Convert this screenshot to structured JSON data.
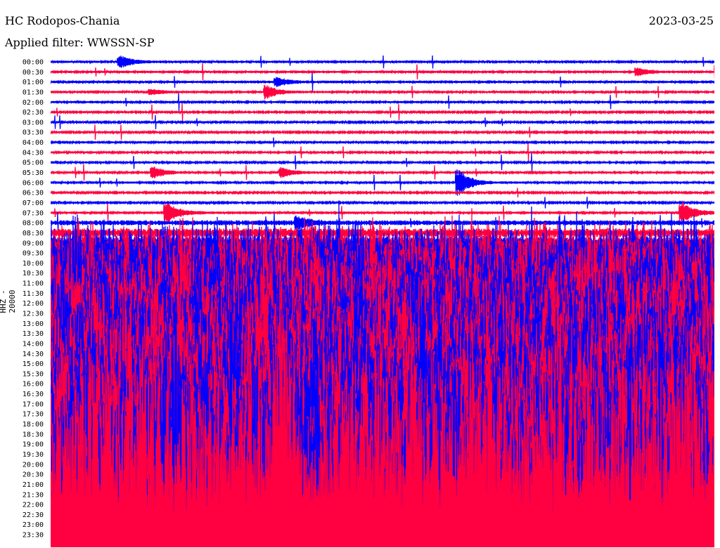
{
  "header": {
    "station": "HC Rodopos-Chania",
    "date": "2023-03-25",
    "filter": "Applied filter: WWSSN-SP",
    "channel": "HHZ - 20000"
  },
  "chart_data": {
    "type": "line",
    "title": "HC Rodopos-Chania",
    "subtitle": "Applied filter: WWSSN-SP",
    "ylabel": "HHZ - 20000",
    "minutes_per_line": 30,
    "colors": {
      "even": "#0000ff",
      "odd": "#ff0040"
    },
    "row_labels": [
      "00:00",
      "00:30",
      "01:00",
      "01:30",
      "02:00",
      "02:30",
      "03:00",
      "03:30",
      "04:00",
      "04:30",
      "05:00",
      "05:30",
      "06:00",
      "06:30",
      "07:00",
      "07:30",
      "08:00",
      "08:30",
      "09:00",
      "09:30",
      "10:00",
      "10:30",
      "11:00",
      "11:30",
      "12:00",
      "12:30",
      "13:00",
      "13:30",
      "14:00",
      "14:30",
      "15:00",
      "15:30",
      "16:00",
      "16:30",
      "17:00",
      "17:30",
      "18:00",
      "18:30",
      "19:00",
      "19:30",
      "20:00",
      "20:30",
      "21:00",
      "21:30",
      "22:00",
      "22:30",
      "23:00",
      "23:30"
    ],
    "relative_amplitude": [
      1.5,
      1.3,
      1.5,
      1.3,
      1.3,
      1,
      1,
      1,
      1.2,
      1.2,
      1.2,
      1.2,
      1.3,
      1,
      1,
      1.5,
      3,
      5,
      7,
      20,
      30,
      35,
      40,
      40,
      45,
      45,
      45,
      50,
      50,
      50,
      55,
      55,
      55,
      60,
      60,
      60,
      65,
      65,
      70,
      70,
      75,
      80,
      85,
      90,
      100,
      110,
      120,
      130
    ],
    "events": [
      {
        "row": 0,
        "minute": 3.2,
        "amplitude": 8
      },
      {
        "row": 1,
        "minute": 26.6,
        "amplitude": 5
      },
      {
        "row": 2,
        "minute": 10.3,
        "amplitude": 6
      },
      {
        "row": 3,
        "minute": 9.8,
        "amplitude": 9
      },
      {
        "row": 3,
        "minute": 4.6,
        "amplitude": 4
      },
      {
        "row": 11,
        "minute": 4.7,
        "amplitude": 8
      },
      {
        "row": 11,
        "minute": 10.5,
        "amplitude": 7
      },
      {
        "row": 12,
        "minute": 18.5,
        "amplitude": 18
      },
      {
        "row": 15,
        "minute": 5.3,
        "amplitude": 14
      },
      {
        "row": 15,
        "minute": 28.6,
        "amplitude": 14
      },
      {
        "row": 16,
        "minute": 11.2,
        "amplitude": 8
      }
    ]
  }
}
